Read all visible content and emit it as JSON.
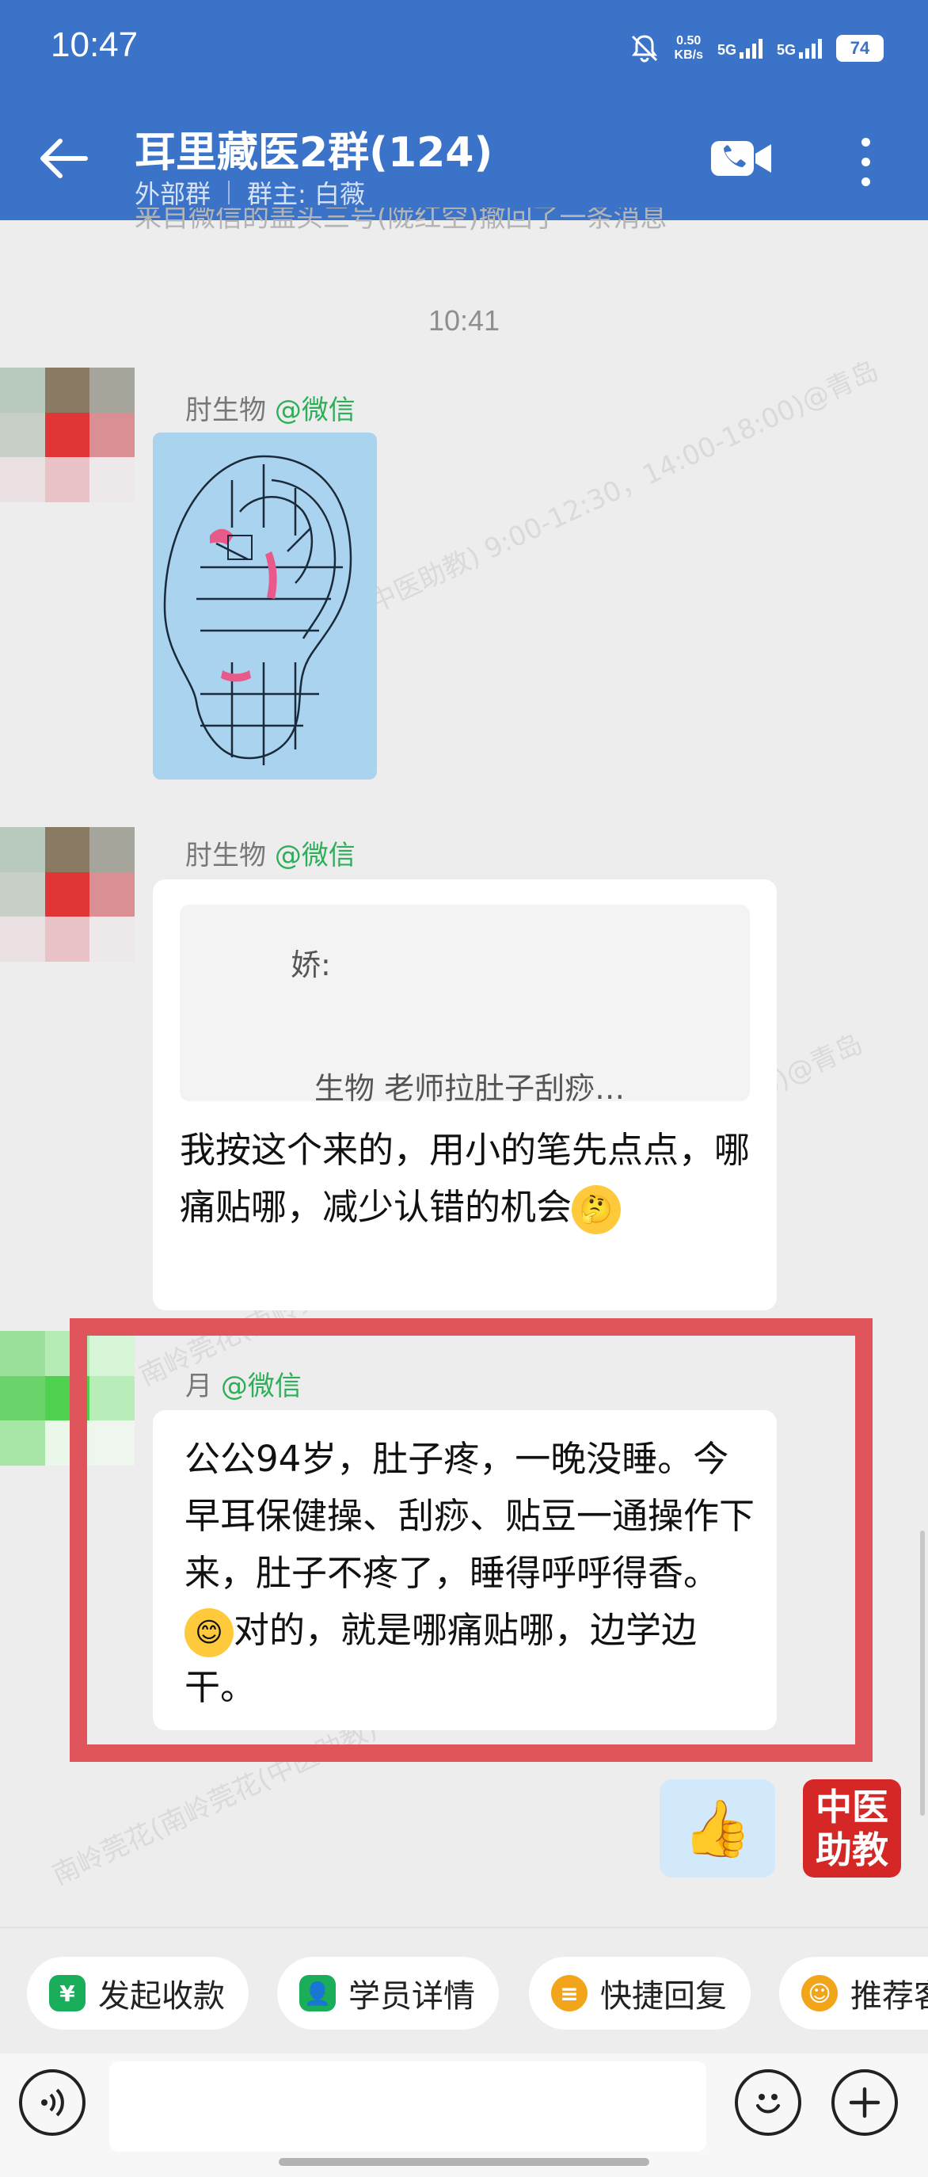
{
  "status_bar": {
    "time": "10:47",
    "speed_value": "0.50",
    "speed_unit": "KB/s",
    "net1": "5G",
    "net2": "5G",
    "battery": "74"
  },
  "header": {
    "title": "耳里藏医2群(124)",
    "group_type": "外部群",
    "owner": "群主: 白薇"
  },
  "chat": {
    "recall_notice": "来自微信的盖头三号(陇红空)撤回了一条消息",
    "time_label": "10:41",
    "messages": [
      {
        "sender": "肘生物",
        "sender_tag": "@微信",
        "type": "image"
      },
      {
        "sender": "肘生物",
        "sender_tag": "@微信",
        "quote_name": "娇:",
        "quote_text": "生物 老师拉肚子刮痧…",
        "text": "我按这个来的，用小的笔先点点，哪痛贴哪，减少认错的机会"
      },
      {
        "sender": "月",
        "sender_tag": "@微信",
        "text_part1": "公公94岁，肚子疼，一晚没睡。今早耳保健操、刮痧、贴豆一通操作下来，肚子不疼了，睡得呼呼得香。",
        "text_part2": "对的，就是哪痛贴哪，边学边干。"
      }
    ],
    "sent_emoji": "👍",
    "logo_text": "中医助教",
    "watermarks": [
      "南岭莞花(南岭莞花(中医助教) 9:00-12:30，14:00-18:00)@青岛",
      "南岭莞花(南岭莞花(中医助教) 9:00-12:30，14:00-18:00)@青岛",
      "南岭莞花(南岭莞花(中医助教) 9:00-12:30，14:00-18:00)@青岛"
    ]
  },
  "quick_actions": [
    {
      "label": "发起收款",
      "icon": "yuan-shield-icon"
    },
    {
      "label": "学员详情",
      "icon": "student-icon"
    },
    {
      "label": "快捷回复",
      "icon": "quick-reply-icon"
    },
    {
      "label": "推荐客",
      "icon": "recommend-icon"
    }
  ],
  "input": {
    "placeholder": ""
  },
  "colors": {
    "header_bg": "#3b73c9",
    "highlight_border": "#e0555c",
    "tag_green": "#2fae5a"
  }
}
